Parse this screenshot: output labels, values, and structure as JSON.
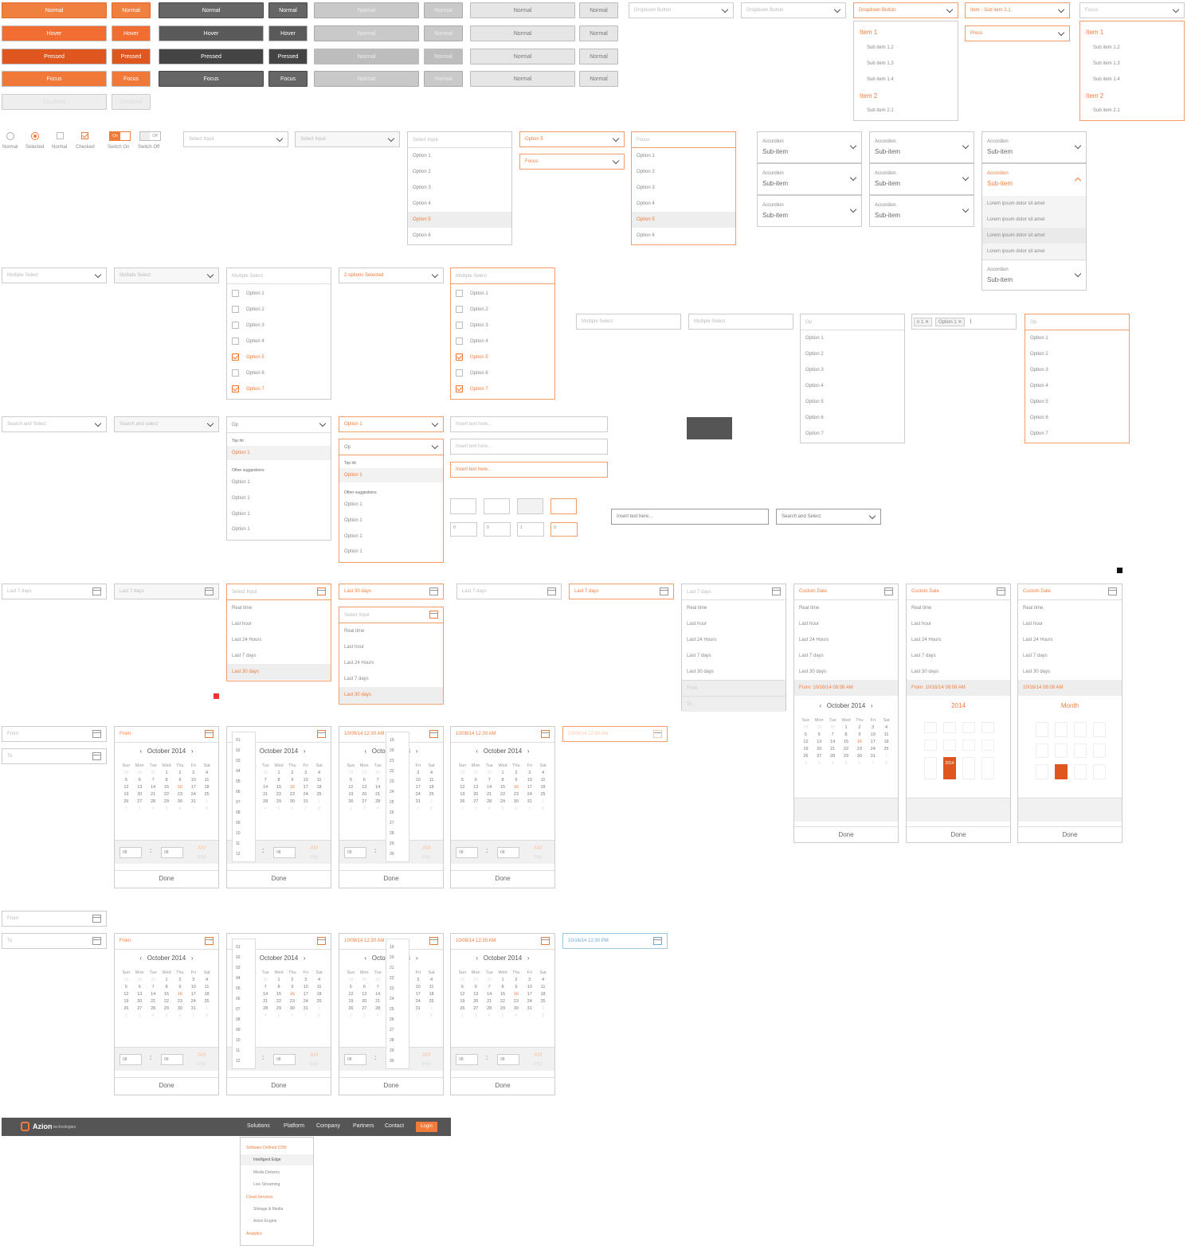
{
  "buttons": {
    "orange": [
      "Normal",
      "Hover",
      "Pressed",
      "Focus"
    ],
    "dark": [
      "Normal",
      "Hover",
      "Pressed",
      "Focus"
    ],
    "gray": [
      "Normal",
      "Normal",
      "Normal",
      "Normal"
    ],
    "light": [
      "Normal",
      "Normal",
      "Normal",
      "Normal"
    ],
    "disabled": "Disabled"
  },
  "dropdown_buttons": {
    "b1": "Dropdown Button",
    "b2": "Dropdown Button",
    "b3": "Dropdown Button",
    "b4": "Item - Sub item 2.1",
    "b5": "Focus",
    "b6": "Press"
  },
  "tree_menu": {
    "item1": "Item 1",
    "sub": [
      "Sub item 1.2",
      "Sub item 1.3",
      "Sub item 1.4"
    ],
    "item2": "Item 2",
    "sub2": "Sub item 2.1"
  },
  "checkboxes": {
    "normal": "Normal",
    "selected": "Selected",
    "normal2": "Normal",
    "checked": "Checked",
    "switch_on": "Switch On",
    "switch_off": "Switch Off",
    "on": "On",
    "off": "Off"
  },
  "selects": {
    "placeholder": "Select Input",
    "focus": "Focus",
    "option5": "Option 5",
    "options": [
      "Option 1",
      "Option 2",
      "Option 3",
      "Option 4",
      "Option 5",
      "Option 6"
    ]
  },
  "accordion": {
    "label": "Accordion",
    "sub": "Sub-item",
    "lorem": "Lorem ipsum dolor sit amet"
  },
  "multi": {
    "placeholder": "Multiple Select",
    "selected": "2 options Selected",
    "options": [
      "Option 1",
      "Option 2",
      "Option 3",
      "Option 4",
      "Option 5",
      "Option 6",
      "Option 7"
    ]
  },
  "tags": {
    "tag1": "Option 1",
    "tag0": "n 1",
    "op_placeholder": "Op"
  },
  "search": {
    "placeholder": "Search and Select",
    "placeholder2": "Search and select",
    "typed": "Op",
    "option1": "Option 1",
    "top_hit": "Top hit",
    "other": "Other suggestions",
    "option_item": "Option 1"
  },
  "text_inputs": {
    "placeholder": "Insert text here...",
    "search": "Search and Select"
  },
  "spinners": [
    "0",
    "0",
    "1",
    "0"
  ],
  "date_ranges": {
    "last7": "Last 7 days",
    "last30": "Last 30 days",
    "select": "Select Input",
    "custom": "Custom Date",
    "options": [
      "Real time",
      "Last hour",
      "Last 24 Hours",
      "Last 7 days",
      "Last 30 days"
    ],
    "from": "From",
    "to": "To",
    "from_date": "From: 10/16/14 08:08 AM",
    "from_date2": "10/16/14 08:08 AM"
  },
  "calendar": {
    "month": "October 2014",
    "year": "2014",
    "month_label": "Month",
    "days": [
      "Sun",
      "Mon",
      "Tue",
      "Wed",
      "Thu",
      "Fri",
      "Sat"
    ],
    "done": "Done",
    "am": "AM",
    "pm": "PM",
    "h": "08",
    "m": "08",
    "dt": "10/09/14 12:30 AM",
    "dt2": "10/16/14 12:30 PM",
    "h12": "12",
    "m30": "30"
  },
  "nav": {
    "brand": "Azion",
    "brand_sub": "technologies",
    "items": [
      "Solutions",
      "Platform",
      "Company",
      "Partners",
      "Contact"
    ],
    "login": "Login",
    "menu": {
      "h1": "Software Defined CDN",
      "items1": [
        "Intelligent Edge",
        "Media Delivery",
        "Live Streaming"
      ],
      "h2": "Cloud Services",
      "items2": [
        "Storage & Media",
        "Azion Engine"
      ],
      "h3": "Analytics"
    }
  },
  "colors": {
    "accent": "#f07b3a",
    "dark": "#555555"
  }
}
